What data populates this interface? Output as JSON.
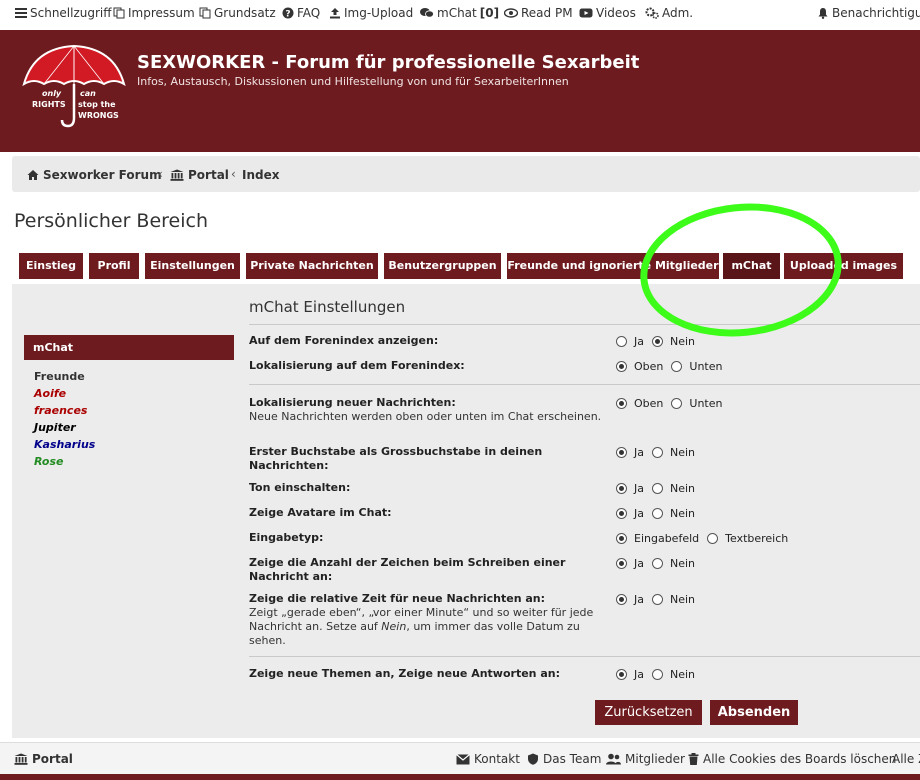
{
  "topnav": {
    "items": [
      {
        "label": "Schnellzugriff",
        "icon": "menu-icon"
      },
      {
        "label": "Impressum",
        "icon": "copy-icon"
      },
      {
        "label": "Grundsatz",
        "icon": "copy-icon"
      },
      {
        "label": "FAQ",
        "icon": "help-icon"
      },
      {
        "label": "Img-Upload",
        "icon": "upload-icon"
      },
      {
        "label": "mChat",
        "icon": "chat-icon",
        "count": "[0]"
      },
      {
        "label": "Read PM",
        "icon": "eye-icon"
      },
      {
        "label": "Videos",
        "icon": "video-icon"
      },
      {
        "label": "Adm.",
        "icon": "gears-icon"
      }
    ],
    "notifications": "Benachrichtigungen"
  },
  "header": {
    "title": "SEXWORKER - Forum für professionelle Sexarbeit",
    "description": "Infos, Austausch, Diskussionen und Hilfestellung von und für SexarbeiterInnen",
    "logo_text": [
      "only",
      "can",
      "RIGHTS",
      "stop the",
      "WRONGS"
    ]
  },
  "breadcrumb": [
    "Sexworker Forum",
    "Portal",
    "Index"
  ],
  "page_title": "Persönlicher Bereich",
  "tabs": [
    "Einstieg",
    "Profil",
    "Einstellungen",
    "Private Nachrichten",
    "Benutzergruppen",
    "Freunde und ignorierte Mitglieder",
    "mChat",
    "Uploaded images"
  ],
  "sidebar": {
    "active": "mChat",
    "friends_label": "Freunde",
    "friends": [
      {
        "name": "Aoife",
        "color": "#aa0000"
      },
      {
        "name": "fraences",
        "color": "#aa0000"
      },
      {
        "name": "Jupiter",
        "color": "#000000"
      },
      {
        "name": "Kasharius",
        "color": "#00008b"
      },
      {
        "name": "Rose",
        "color": "#228b22"
      }
    ]
  },
  "settings": {
    "title": "mChat Einstellungen",
    "rows": [
      {
        "label": "Auf dem Forenindex anzeigen:",
        "options": [
          "Ja",
          "Nein"
        ],
        "selected": 1
      },
      {
        "label": "Lokalisierung auf dem Forenindex:",
        "options": [
          "Oben",
          "Unten"
        ],
        "selected": 0
      },
      {
        "label": "Lokalisierung neuer Nachrichten:",
        "explain": "Neue Nachrichten werden oben oder unten im Chat erscheinen.",
        "options": [
          "Oben",
          "Unten"
        ],
        "selected": 0
      },
      {
        "label": "Erster Buchstabe als Grossbuchstabe in deinen Nachrichten:",
        "options": [
          "Ja",
          "Nein"
        ],
        "selected": 0
      },
      {
        "label": "Ton einschalten:",
        "options": [
          "Ja",
          "Nein"
        ],
        "selected": 0
      },
      {
        "label": "Zeige Avatare im Chat:",
        "options": [
          "Ja",
          "Nein"
        ],
        "selected": 0
      },
      {
        "label": "Eingabetyp:",
        "options": [
          "Eingabefeld",
          "Textbereich"
        ],
        "selected": 0
      },
      {
        "label": "Zeige die Anzahl der Zeichen beim Schreiben einer Nachricht an:",
        "options": [
          "Ja",
          "Nein"
        ],
        "selected": 0
      },
      {
        "label": "Zeige die relative Zeit für neue Nachrichten an:",
        "explain_parts": [
          "Zeigt „gerade eben“, „vor einer Minute“ und so weiter für jede Nachricht an. Setze auf ",
          "Nein",
          ", um immer das volle Datum zu sehen."
        ],
        "options": [
          "Ja",
          "Nein"
        ],
        "selected": 0
      },
      {
        "label": "Zeige neue Themen an, Zeige neue Antworten an:",
        "options": [
          "Ja",
          "Nein"
        ],
        "selected": 0
      }
    ],
    "reset_label": "Zurücksetzen",
    "submit_label": "Absenden"
  },
  "footer": {
    "portal": "Portal",
    "links": [
      "Kontakt",
      "Das Team",
      "Mitglieder",
      "Alle Cookies des Boards löschen",
      "Alle Z"
    ]
  },
  "colors": {
    "brand": "#6e1b1f",
    "highlight": "#3dfc1a"
  }
}
